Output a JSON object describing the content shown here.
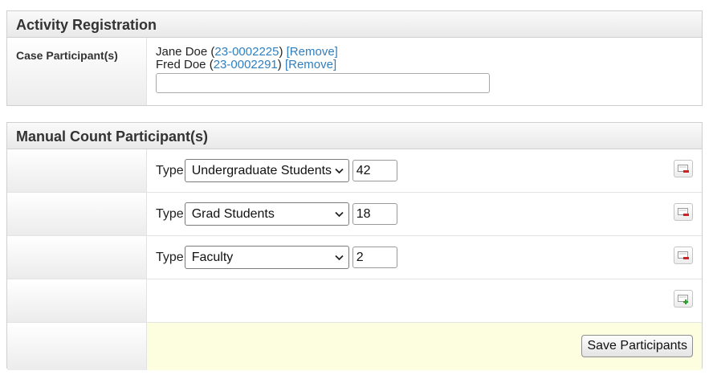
{
  "activity_registration": {
    "title": "Activity Registration",
    "case_label": "Case Participant(s)",
    "participants": [
      {
        "name": "Jane Doe",
        "id": "23-0002225",
        "remove_label": "[Remove]"
      },
      {
        "name": "Fred Doe",
        "id": "23-0002291",
        "remove_label": "[Remove]"
      }
    ],
    "search": {
      "value": "",
      "placeholder": ""
    }
  },
  "manual_count": {
    "title": "Manual Count Participant(s)",
    "type_label": "Type",
    "rows": [
      {
        "type": "Undergraduate Students",
        "count": "42"
      },
      {
        "type": "Grad Students",
        "count": "18"
      },
      {
        "type": "Faculty",
        "count": "2"
      }
    ],
    "save_label": "Save Participants"
  },
  "colors": {
    "link": "#2f7fbf",
    "save_row_background": "#fdfde0",
    "remove_icon_accent": "#cc2222",
    "add_icon_accent": "#2a9d2a"
  },
  "icons": {
    "search": "search-icon",
    "remove_row": "remove-row-icon",
    "add_row": "add-row-icon",
    "select_arrow": "chevron-down-icon"
  }
}
